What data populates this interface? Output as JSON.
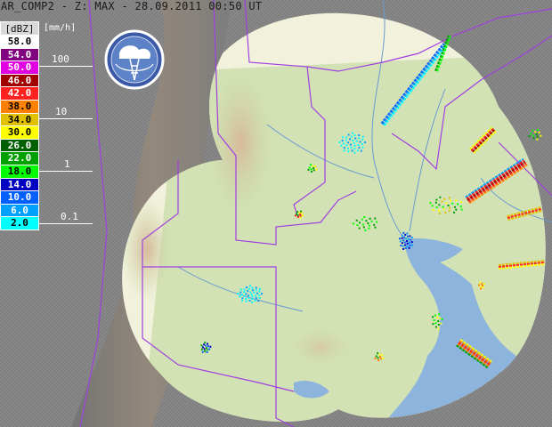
{
  "title": "AR_COMP2 - Z: MAX - 28.09.2011 00:50 UT",
  "legend": {
    "header": "[dBZ]",
    "rows": [
      {
        "label": "58.0",
        "color": "#ffffff",
        "text_color": "#000000"
      },
      {
        "label": "54.0",
        "color": "#800080",
        "text_color": "#ffffff"
      },
      {
        "label": "50.0",
        "color": "#e000e0",
        "text_color": "#ffffff"
      },
      {
        "label": "46.0",
        "color": "#a00000",
        "text_color": "#ffffff"
      },
      {
        "label": "42.0",
        "color": "#ff2020",
        "text_color": "#ffffff"
      },
      {
        "label": "38.0",
        "color": "#ff8000",
        "text_color": "#000000"
      },
      {
        "label": "34.0",
        "color": "#e0c000",
        "text_color": "#000000"
      },
      {
        "label": "30.0",
        "color": "#ffff00",
        "text_color": "#000000"
      },
      {
        "label": "26.0",
        "color": "#006000",
        "text_color": "#ffffff"
      },
      {
        "label": "22.0",
        "color": "#00a000",
        "text_color": "#ffffff"
      },
      {
        "label": "18.0",
        "color": "#00ff00",
        "text_color": "#000000"
      },
      {
        "label": "14.0",
        "color": "#0000c0",
        "text_color": "#ffffff"
      },
      {
        "label": "10.0",
        "color": "#0060ff",
        "text_color": "#ffffff"
      },
      {
        "label": "6.0",
        "color": "#00a0ff",
        "text_color": "#ffffff"
      },
      {
        "label": "2.0",
        "color": "#00ffff",
        "text_color": "#000000"
      }
    ]
  },
  "rain_scale": {
    "unit": "[mm/h]",
    "labels": [
      "100",
      "10",
      "1",
      "0.1"
    ]
  },
  "colors": {
    "background": "#7f7f7f",
    "coverage": "#f2f2dc",
    "land": "#c8dca8",
    "water": "#8cb4dc",
    "border": "#a040e0",
    "river": "#6a9ad0"
  },
  "logo": {
    "icon": "weather-radar-emblem"
  }
}
